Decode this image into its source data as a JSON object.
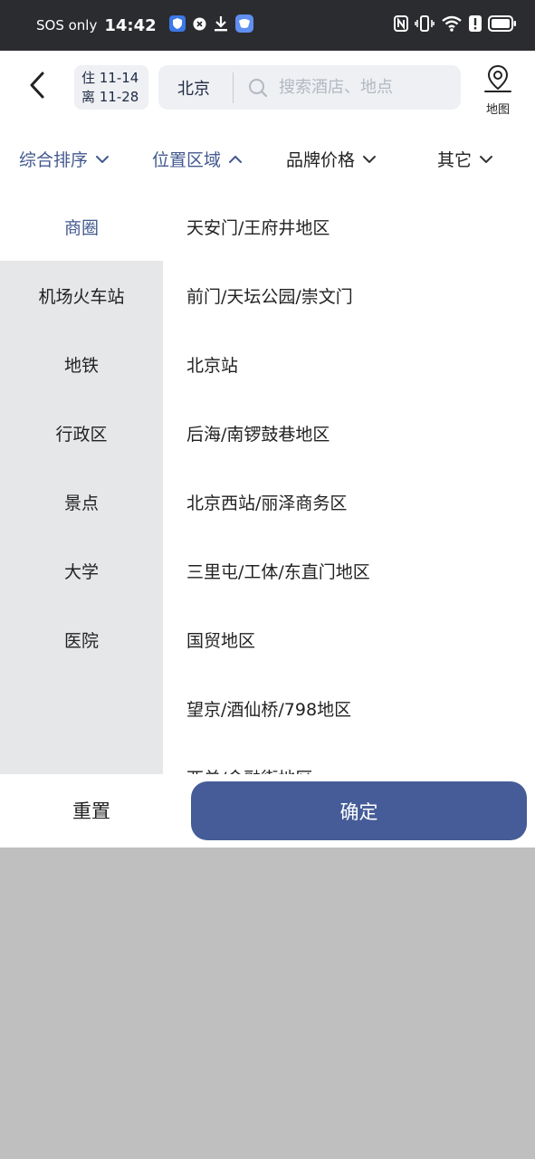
{
  "status_bar": {
    "carrier": "SOS only",
    "time": "14:42"
  },
  "header": {
    "check_in": "住 11-14",
    "check_out": "离 11-28",
    "city": "北京",
    "search_placeholder": "搜索酒店、地点",
    "map_label": "地图"
  },
  "filters": {
    "tabs": [
      {
        "label": "综合排序",
        "state": "collapsed"
      },
      {
        "label": "位置区域",
        "state": "expanded"
      },
      {
        "label": "品牌价格",
        "state": "collapsed"
      },
      {
        "label": "其它",
        "state": "collapsed"
      }
    ]
  },
  "location_panel": {
    "categories": [
      "商圈",
      "机场火车站",
      "地铁",
      "行政区",
      "景点",
      "大学",
      "医院"
    ],
    "selected_category": "商圈",
    "areas": [
      "天安门/王府井地区",
      "前门/天坛公园/崇文门",
      "北京站",
      "后海/南锣鼓巷地区",
      "北京西站/丽泽商务区",
      "三里屯/工体/东直门地区",
      "国贸地区",
      "望京/酒仙桥/798地区",
      "西单/金融街地区"
    ]
  },
  "actions": {
    "reset_label": "重置",
    "confirm_label": "确定"
  },
  "colors": {
    "accent": "#43598f",
    "confirm_button": "#455c98",
    "status_bar": "#2b2c2f",
    "nav_background": "#e6e7e9",
    "overlay": "#bfbfbf"
  }
}
